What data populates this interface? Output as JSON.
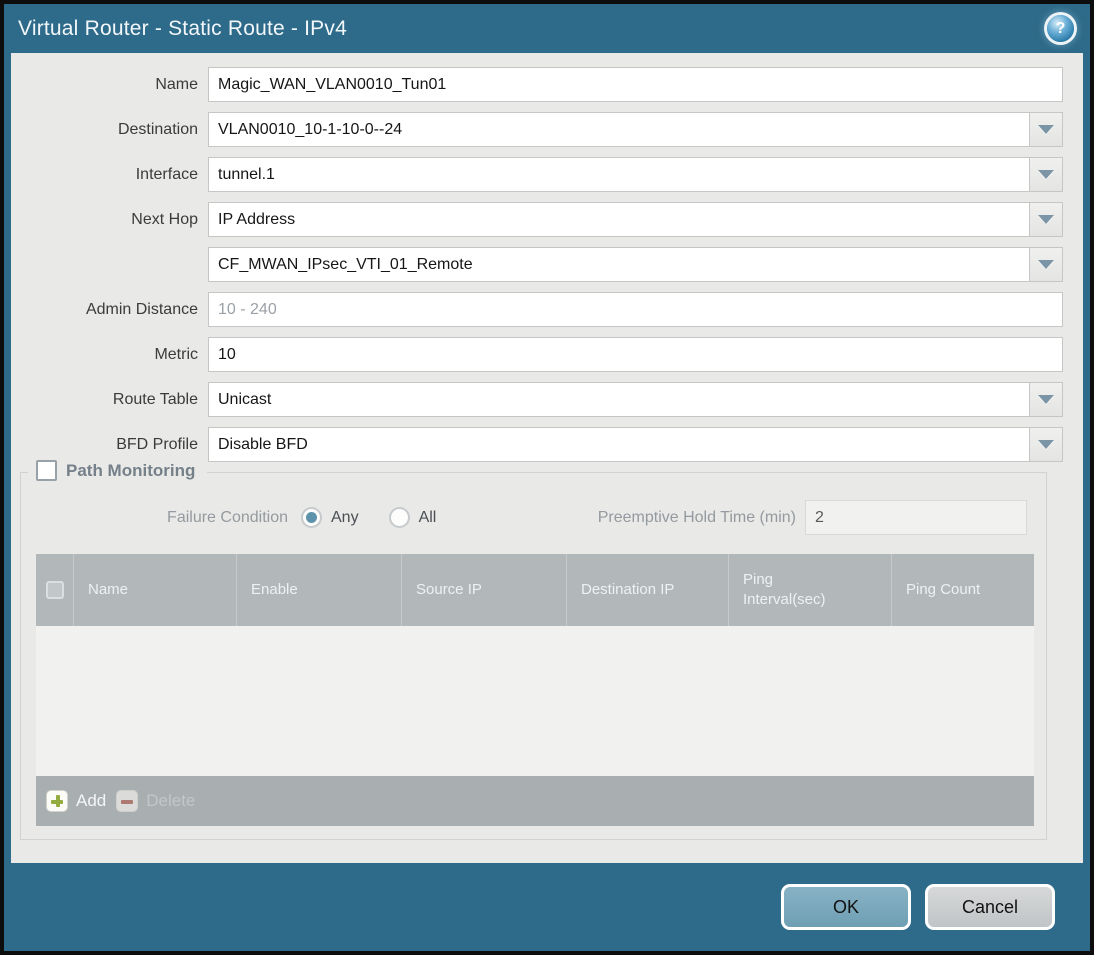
{
  "window": {
    "title": "Virtual Router - Static Route - IPv4",
    "help_icon": "?"
  },
  "form": {
    "name": {
      "label": "Name",
      "value": "Magic_WAN_VLAN0010_Tun01"
    },
    "destination": {
      "label": "Destination",
      "value": "VLAN0010_10-1-10-0--24"
    },
    "interface": {
      "label": "Interface",
      "value": "tunnel.1"
    },
    "next_hop": {
      "label": "Next Hop",
      "value": "IP Address"
    },
    "next_hop_address": {
      "value": "CF_MWAN_IPsec_VTI_01_Remote"
    },
    "admin_distance": {
      "label": "Admin Distance",
      "placeholder": "10 - 240",
      "value": ""
    },
    "metric": {
      "label": "Metric",
      "value": "10"
    },
    "route_table": {
      "label": "Route Table",
      "value": "Unicast"
    },
    "bfd_profile": {
      "label": "BFD Profile",
      "value": "Disable BFD"
    }
  },
  "path_monitoring": {
    "title": "Path Monitoring",
    "enabled": false,
    "failure_condition": {
      "label": "Failure Condition",
      "option_any": "Any",
      "option_all": "All",
      "selected": "Any"
    },
    "preemptive_hold_time": {
      "label": "Preemptive Hold Time (min)",
      "value": "2"
    },
    "table": {
      "columns": [
        "Name",
        "Enable",
        "Source IP",
        "Destination IP",
        "Ping Interval(sec)",
        "Ping Count"
      ],
      "rows": []
    },
    "toolbar": {
      "add": "Add",
      "delete": "Delete"
    }
  },
  "footer": {
    "ok": "OK",
    "cancel": "Cancel"
  },
  "colors": {
    "titlebar": "#2e6a89",
    "body_bg": "#e9e9e7",
    "table_header": "#b2b7ba",
    "toolbar_bg": "#a9aeb1",
    "ok_button": "#7ca8bc",
    "cancel_button": "#c9cccd",
    "radio_selected": "#5e93ab",
    "add_icon_green": "#93ab3f",
    "delete_icon_red": "#ad6e60",
    "dropdown_arrow": "#7b95a7"
  }
}
